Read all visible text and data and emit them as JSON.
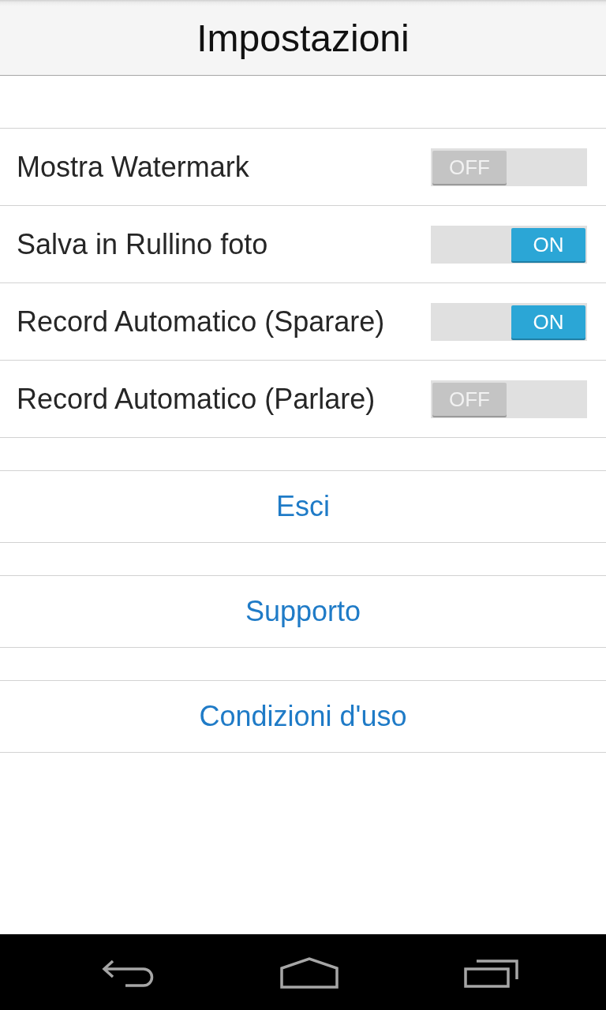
{
  "header": {
    "title": "Impostazioni"
  },
  "settings": [
    {
      "label": "Mostra Watermark",
      "on": false,
      "state_text": "OFF"
    },
    {
      "label": "Salva in Rullino foto",
      "on": true,
      "state_text": "ON"
    },
    {
      "label": "Record Automatico (Sparare)",
      "on": true,
      "state_text": "ON"
    },
    {
      "label": "Record Automatico (Parlare)",
      "on": false,
      "state_text": "OFF"
    }
  ],
  "links": [
    {
      "label": "Esci"
    },
    {
      "label": "Supporto"
    },
    {
      "label": "Condizioni d'uso"
    }
  ]
}
